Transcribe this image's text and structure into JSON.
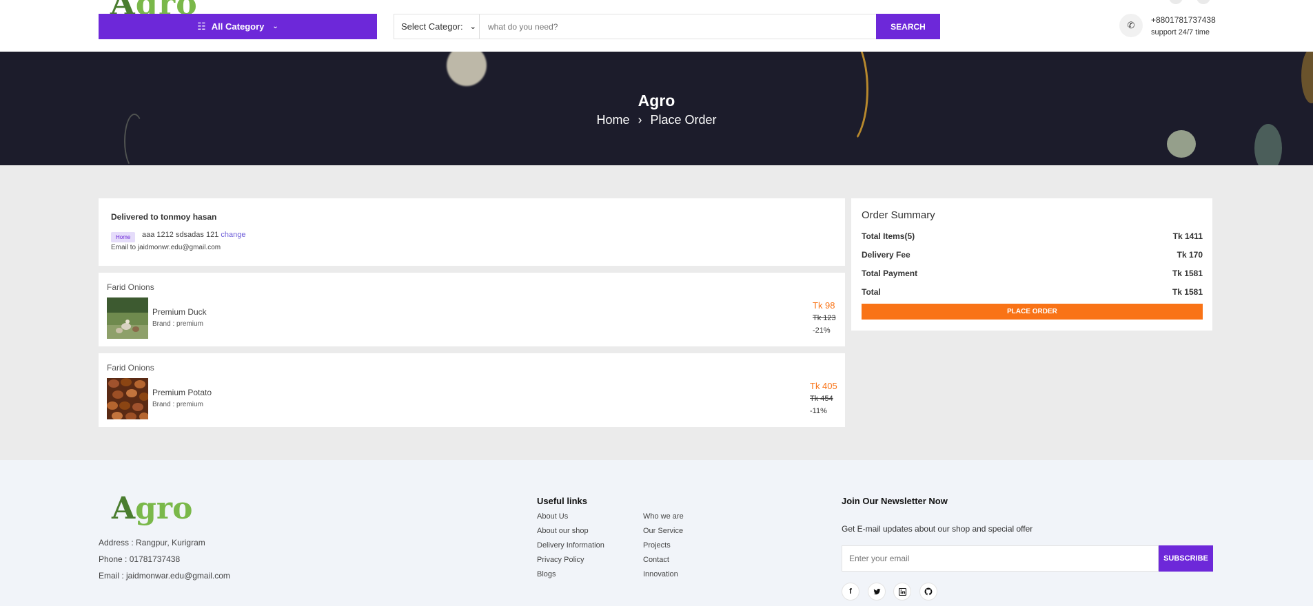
{
  "header": {
    "logo_text": "Agro",
    "category_button": "All Category",
    "search": {
      "select_value": "Select Categor:",
      "placeholder": "what do you need?",
      "button": "SEARCH"
    },
    "phone": "+8801781737438",
    "support": "support 24/7 time"
  },
  "banner": {
    "title": "Agro",
    "breadcrumb": [
      "Home",
      "Place Order"
    ],
    "separator": "›"
  },
  "delivery": {
    "title": "Delivered to tonmoy hasan",
    "badge": "Home",
    "address": "aaa 1212 sdsadas 121",
    "change_link": "change",
    "email": "Email to jaidmonwr.edu@gmail.com"
  },
  "orders": [
    {
      "shop": "Farid Onions",
      "product": "Premium Duck",
      "brand": "Brand : premium",
      "price": "Tk 98",
      "old_price": "Tk 123",
      "discount": "-21%"
    },
    {
      "shop": "Farid Onions",
      "product": "Premium Potato",
      "brand": "Brand : premium",
      "price": "Tk 405",
      "old_price": "Tk 454",
      "discount": "-11%"
    }
  ],
  "summary": {
    "title": "Order Summary",
    "rows": [
      {
        "label": "Total Items(5)",
        "value": "Tk 1411"
      },
      {
        "label": "Delivery Fee",
        "value": "Tk 170"
      },
      {
        "label": "Total Payment",
        "value": "Tk 1581"
      },
      {
        "label": "Total",
        "value": "Tk 1581"
      }
    ],
    "button": "PLACE ORDER"
  },
  "footer": {
    "logo_text": "Agro",
    "address": "Address : Rangpur, Kurigram",
    "phone": "Phone : 01781737438",
    "email": "Email : jaidmonwar.edu@gmail.com",
    "useful_links_title": "Useful links",
    "links_col1": [
      "About Us",
      "About our shop",
      "Delivery Information",
      "Privacy Policy",
      "Blogs"
    ],
    "links_col2": [
      "Who we are",
      "Our Service",
      "Projects",
      "Contact",
      "Innovation"
    ],
    "newsletter_title": "Join Our Newsletter Now",
    "newsletter_sub": "Get E-mail updates about our shop and special offer",
    "newsletter_placeholder": "Enter your email",
    "subscribe": "SUBSCRIBE",
    "social_icons": [
      "facebook-icon",
      "twitter-icon",
      "linkedin-icon",
      "github-icon"
    ]
  },
  "colors": {
    "primary": "#6d28d9",
    "accent": "#f97316",
    "logo_green": "#7ab84a",
    "banner_bg": "#1c1c2b"
  }
}
